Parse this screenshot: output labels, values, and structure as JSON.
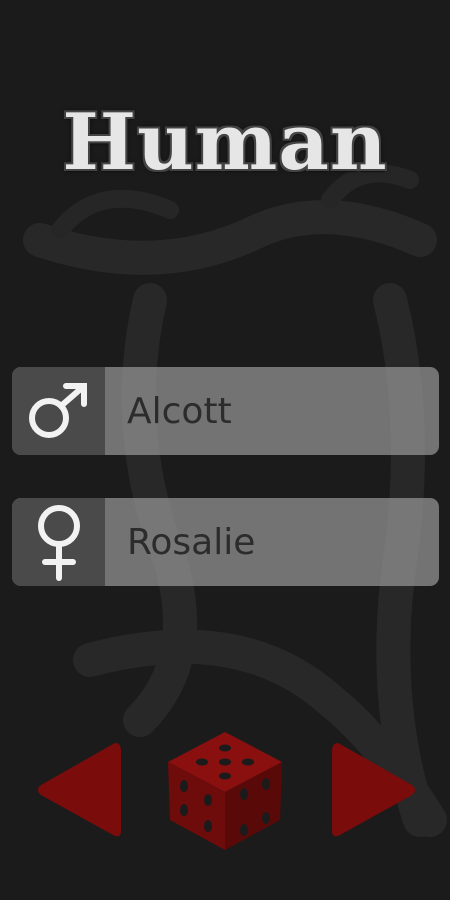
{
  "screen": {
    "title": "Human"
  },
  "names": {
    "male": {
      "icon": "male-symbol-icon",
      "label": "Alcott"
    },
    "female": {
      "icon": "female-symbol-icon",
      "label": "Rosalie"
    }
  },
  "controls": {
    "previous_icon": "triangle-left-icon",
    "randomize_icon": "dice-icon",
    "next_icon": "triangle-right-icon"
  },
  "colors": {
    "background": "#1b1b1b",
    "title_text": "#e6e6e6",
    "row_background": "#969696",
    "icon_box": "#4a4a4a",
    "name_text": "#2c2c2c",
    "accent_red": "#7a0c0c"
  }
}
